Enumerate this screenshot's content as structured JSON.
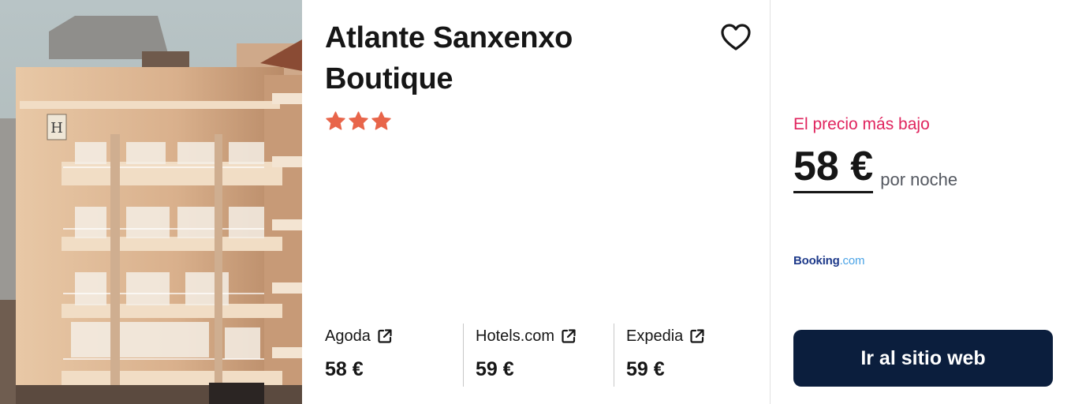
{
  "hotel": {
    "name": "Atlante Sanxenxo Boutique",
    "star_count": 3,
    "star_color": "#e8654a"
  },
  "providers": [
    {
      "name": "Agoda",
      "price": "58 €"
    },
    {
      "name": "Hotels.com",
      "price": "59 €"
    },
    {
      "name": "Expedia",
      "price": "59 €"
    }
  ],
  "best_deal": {
    "label": "El precio más bajo",
    "price": "58 €",
    "unit": "por noche",
    "provider_part1": "Booking",
    "provider_part2": ".com",
    "cta": "Ir al sitio web"
  },
  "colors": {
    "accent_pink": "#e0245e",
    "cta_bg": "#0b1e3d",
    "booking_dark": "#1e3a8a",
    "booking_light": "#4aa3e6"
  },
  "icons": {
    "favorite": "heart-outline-icon",
    "external": "external-link-icon",
    "rating": "star-icon"
  }
}
